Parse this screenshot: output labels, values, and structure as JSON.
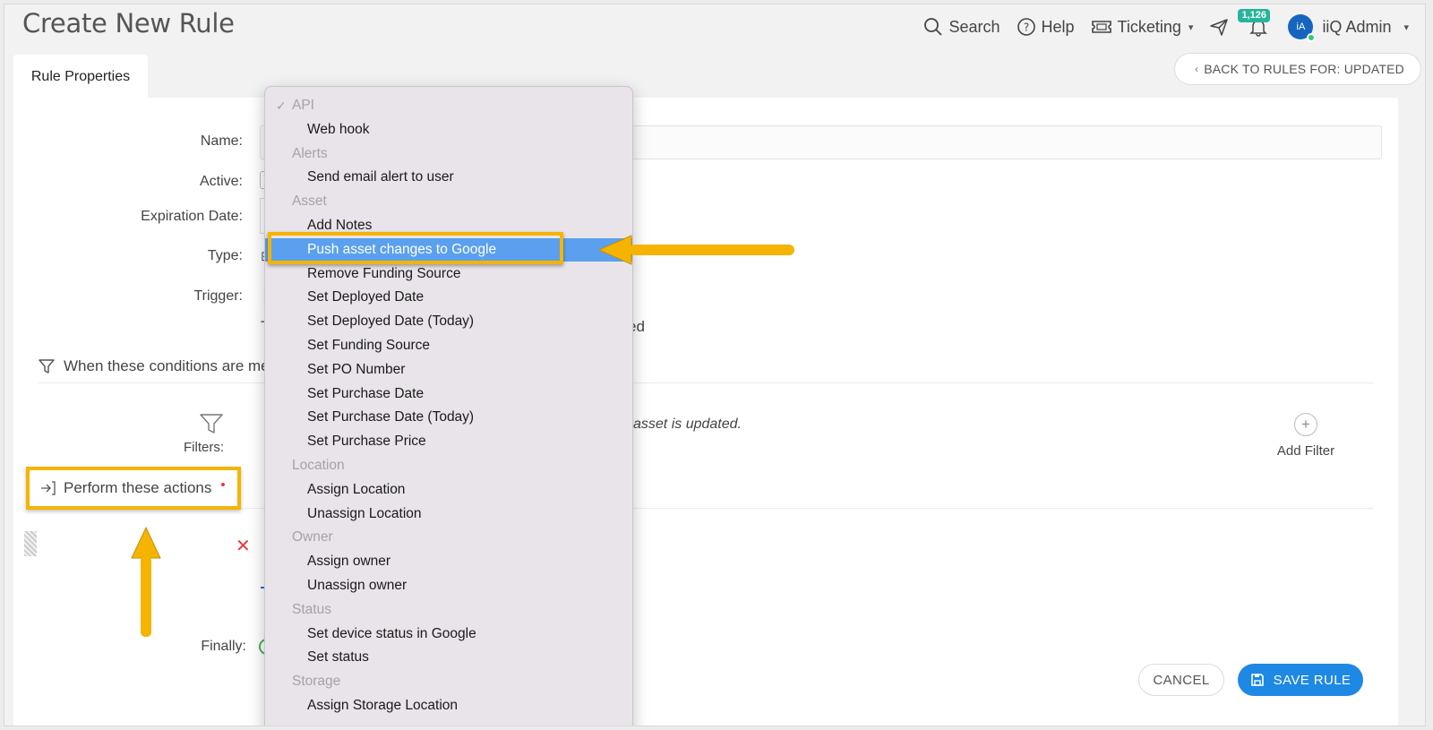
{
  "header": {
    "page_title": "Create New Rule",
    "nav": {
      "search_label": "Search",
      "help_label": "Help",
      "ticketing_label": "Ticketing",
      "notification_count": "1,126",
      "avatar_initials": "iA",
      "user_name": "iiQ Admin"
    }
  },
  "tabs": {
    "rule_properties": "Rule Properties"
  },
  "back_button": {
    "label": "BACK TO RULES FOR: UPDATED"
  },
  "form": {
    "name_label": "Name:",
    "active_label": "Active:",
    "expiration_label": "Expiration Date:",
    "type_label": "Type:",
    "trigger_label": "Trigger:",
    "trigger_text_start": "T",
    "trigger_text_end": "ed",
    "conditions_heading": "When these conditions are me",
    "filters_label": "Filters:",
    "asset_updated_text": "asset is updated.",
    "add_filter_label": "Add Filter",
    "perform_actions_label": "Perform these actions",
    "required_marker": "•",
    "finally_label": "Finally:"
  },
  "buttons": {
    "cancel": "CANCEL",
    "save": "SAVE RULE"
  },
  "action_menu": {
    "selected": "Push asset changes to Google",
    "groups": [
      {
        "label": "API",
        "checked": true,
        "items": [
          "Web hook"
        ]
      },
      {
        "label": "Alerts",
        "items": [
          "Send email alert to user"
        ]
      },
      {
        "label": "Asset",
        "items": [
          "Add Notes",
          "Push asset changes to Google",
          "Remove Funding Source",
          "Set Deployed Date",
          "Set Deployed Date (Today)",
          "Set Funding Source",
          "Set PO Number",
          "Set Purchase Date",
          "Set Purchase Date (Today)",
          "Set Purchase Price"
        ]
      },
      {
        "label": "Location",
        "items": [
          "Assign Location",
          "Unassign Location"
        ]
      },
      {
        "label": "Owner",
        "items": [
          "Assign owner",
          "Unassign owner"
        ]
      },
      {
        "label": "Status",
        "items": [
          "Set device status in Google",
          "Set status"
        ]
      },
      {
        "label": "Storage",
        "items": [
          "Assign Storage Location"
        ]
      }
    ]
  },
  "colors": {
    "accent": "#1e88e5",
    "highlight": "#f5b400",
    "selected_row": "#5aa0ee",
    "badge": "#26b49a"
  }
}
